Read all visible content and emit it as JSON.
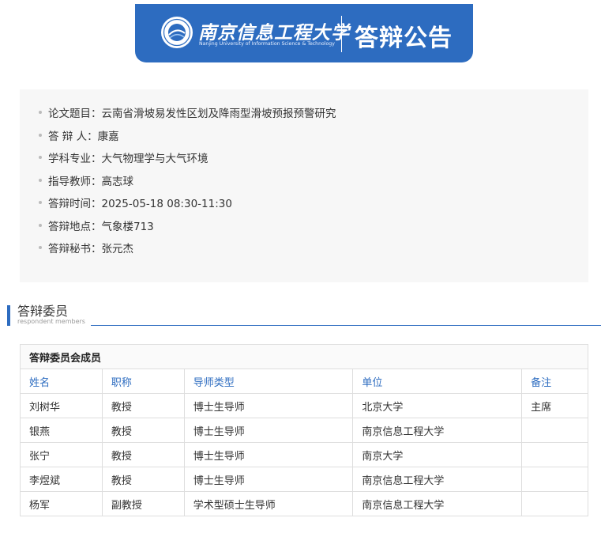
{
  "banner": {
    "school_cn": "南京信息工程大学",
    "school_en": "Nanjing University of Information Science & Technology",
    "title": "答辩公告"
  },
  "info": [
    {
      "label": "论文题目：",
      "value": "云南省滑坡易发性区划及降雨型滑坡预报预警研究"
    },
    {
      "label": "答 辩 人：",
      "value": "康嘉"
    },
    {
      "label": "学科专业：",
      "value": "大气物理学与大气环境"
    },
    {
      "label": "指导教师：",
      "value": "高志球"
    },
    {
      "label": "答辩时间：",
      "value": "2025-05-18 08:30-11:30"
    },
    {
      "label": "答辩地点：",
      "value": "气象楼713"
    },
    {
      "label": "答辩秘书：",
      "value": "张元杰"
    }
  ],
  "section": {
    "title": "答辩委员",
    "subtitle": "respondent members"
  },
  "committee": {
    "caption": "答辩委员会成员",
    "headers": [
      "姓名",
      "职称",
      "导师类型",
      "单位",
      "备注"
    ],
    "rows": [
      [
        "刘树华",
        "教授",
        "博士生导师",
        "北京大学",
        "主席"
      ],
      [
        "银燕",
        "教授",
        "博士生导师",
        "南京信息工程大学",
        ""
      ],
      [
        "张宁",
        "教授",
        "博士生导师",
        "南京大学",
        ""
      ],
      [
        "李煜斌",
        "教授",
        "博士生导师",
        "南京信息工程大学",
        ""
      ],
      [
        "杨军",
        "副教授",
        "学术型硕士生导师",
        "南京信息工程大学",
        ""
      ]
    ]
  },
  "colors": {
    "brand": "#2d6cc0",
    "panel": "#f7f7f7"
  }
}
